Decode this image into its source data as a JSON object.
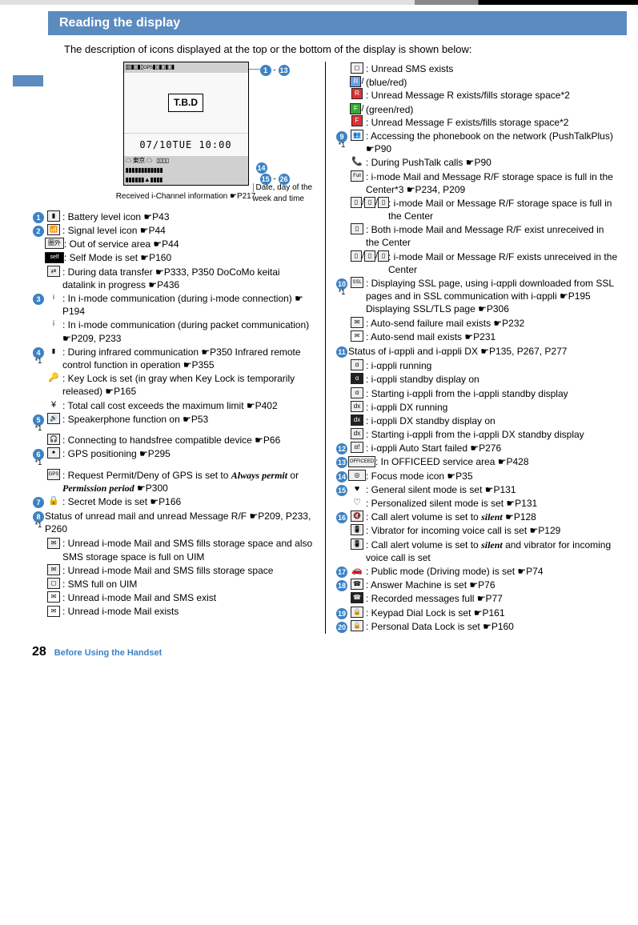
{
  "header": "Reading the display",
  "intro": "The description of icons displayed at the top or the bottom of the display is shown below:",
  "diagram": {
    "tbd": "T.B.D",
    "time": "07/10TUE 10:00",
    "side_note": "Date, day of the week and time",
    "caption": "Received i-Channel information ☛P217",
    "range_top": "① - ⑬",
    "range_bot_a": "⑭",
    "range_bot_b": "⑮ - ㉖"
  },
  "left": {
    "n1": "1",
    "n1_t": ": Battery level icon ☛P43",
    "n2": "2",
    "n2_a": ": Signal level icon ☛P44",
    "n2_b_icon": "圏外",
    "n2_b": ": Out of service area ☛P44",
    "n2_c_icon": "self",
    "n2_c": ": Self Mode is set ☛P160",
    "n2_d": ": During data transfer ☛P333, P350 DoCoMo keitai datalink in progress ☛P436",
    "n3": "3",
    "n3_a": ": In i-mode communication (during i-mode connection) ☛P194",
    "n3_b": ": In i-mode communication (during packet communication) ☛P209, P233",
    "n4": "4",
    "n4_a": ": During infrared communication ☛P350 Infrared remote control function in operation ☛P355",
    "n4_b": ": Key Lock is set (in gray when Key Lock is temporarily released) ☛P165",
    "n4_c": ": Total call cost exceeds the maximum limit ☛P402",
    "n5": "5",
    "n5_a": ": Speakerphone function on ☛P53",
    "n5_b": ": Connecting to handsfree compatible device ☛P66",
    "n6": "6",
    "n6_a": ": GPS positioning ☛P295",
    "n6_b_prefix": ": Request Permit/Deny of GPS is set to ",
    "n6_b_em1": "Always permit",
    "n6_b_mid": " or ",
    "n6_b_em2": "Permission period",
    "n6_b_suffix": " ☛P300",
    "n7": "7",
    "n7_a": ": Secret Mode is set ☛P166",
    "n8": "8",
    "n8_head": "Status of unread mail and unread Message R/F ☛P209, P233, P260",
    "n8_a": ": Unread i-mode Mail and SMS fills storage space and also SMS storage space is full on UIM",
    "n8_b": ": Unread i-mode Mail and SMS fills storage space",
    "n8_c": ": SMS full on UIM",
    "n8_d": ": Unread i-mode Mail and SMS exist",
    "n8_e": ": Unread i-mode Mail exists"
  },
  "right": {
    "r_sms": ": Unread SMS exists",
    "r_br": " (blue/red)",
    "r_br_t": ": Unread Message R exists/fills storage space*2",
    "r_gr": " (green/red)",
    "r_gr_t": ": Unread Message F exists/fills storage space*2",
    "n9": "9",
    "n9_a": ": Accessing the phonebook on the network (PushTalkPlus) ☛P90",
    "n9_b": ": During PushTalk calls ☛P90",
    "n9_c": ": i-mode Mail and Message R/F storage space is full in the Center*3 ☛P234, P209",
    "n9_d": ": i-mode Mail or Message R/F storage space is full in the Center",
    "n9_e": ": Both i-mode Mail and Message R/F exist unreceived in the Center",
    "n9_f": ": i-mode Mail or Message R/F exists unreceived in the Center",
    "n10": "10",
    "n10_a": ": Displaying SSL page, using i-αppli downloaded from SSL pages and in SSL communication with i-αppli ☛P195 Displaying SSL/TLS page ☛P306",
    "n10_b": ": Auto-send failure mail exists ☛P232",
    "n10_c": ": Auto-send mail exists ☛P231",
    "n11": "11",
    "n11_head": "Status of i-αppli and i-αppli DX ☛P135, P267, P277",
    "n11_a": ": i-αppli running",
    "n11_b": ": i-αppli standby display on",
    "n11_c": ": Starting i-αppli from the i-αppli standby display",
    "n11_d": ": i-αppli DX running",
    "n11_e": ": i-αppli DX standby display on",
    "n11_f": ": Starting i-αppli from the i-αppli DX standby display",
    "n12": "12",
    "n12_a": ": i-αppli Auto Start failed ☛P276",
    "n13": "13",
    "n13_icon": "OFFICEED",
    "n13_a": ": In OFFICEED service area ☛P428",
    "n14": "14",
    "n14_a": ": Focus mode icon ☛P35",
    "n15": "15",
    "n15_a": ": General silent mode is set ☛P131",
    "n15_b": ": Personalized silent mode is set ☛P131",
    "n16": "16",
    "n16_a_prefix": ": Call alert volume is set to ",
    "n16_a_em": "silent",
    "n16_a_suffix": " ☛P128",
    "n16_b": ": Vibrator for incoming voice call is set ☛P129",
    "n16_c_prefix": ": Call alert volume is set to ",
    "n16_c_em": "silent",
    "n16_c_suffix": " and vibrator for incoming voice call is set",
    "n17": "17",
    "n17_a": ": Public mode (Driving mode) is set ☛P74",
    "n18": "18",
    "n18_a": ": Answer Machine is set ☛P76",
    "n18_b": ": Recorded messages full ☛P77",
    "n19": "19",
    "n19_a": ": Keypad Dial Lock is set ☛P161",
    "n20": "20",
    "n20_a": ": Personal Data Lock is set ☛P160"
  },
  "star1": "*1",
  "footer": {
    "page": "28",
    "section": "Before Using the Handset"
  }
}
